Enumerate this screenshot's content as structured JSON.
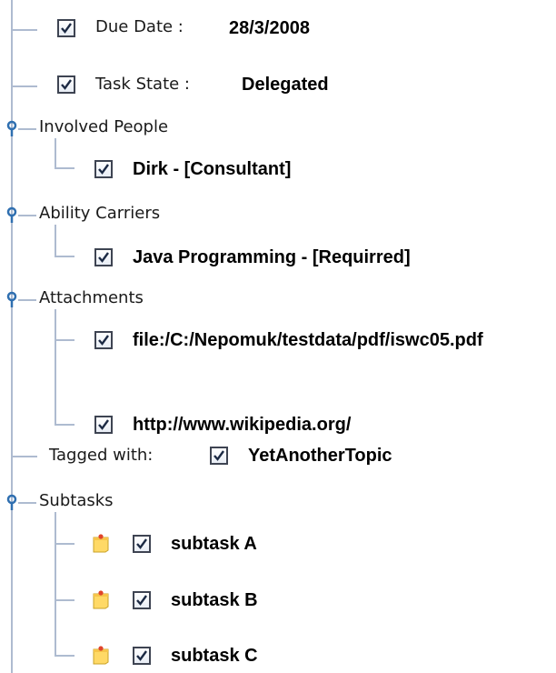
{
  "due_date": {
    "label": "Due Date :",
    "value": "28/3/2008",
    "checked": true
  },
  "task_state": {
    "label": "Task State :",
    "value": "Delegated",
    "checked": true
  },
  "involved_people": {
    "label": "Involved People",
    "items": [
      {
        "value": "Dirk - [Consultant]",
        "checked": true
      }
    ]
  },
  "ability_carriers": {
    "label": "Ability Carriers",
    "items": [
      {
        "value": "Java Programming - [Requirred]",
        "checked": true
      }
    ]
  },
  "attachments": {
    "label": "Attachments",
    "items": [
      {
        "value": "file:/C:/Nepomuk/testdata/pdf/iswc05.pdf",
        "checked": true
      },
      {
        "value": "http://www.wikipedia.org/",
        "checked": true
      }
    ]
  },
  "tagged_with": {
    "label": "Tagged with:",
    "value": "YetAnotherTopic",
    "checked": true
  },
  "subtasks": {
    "label": "Subtasks",
    "items": [
      {
        "value": "subtask A",
        "checked": true,
        "icon": "note-icon"
      },
      {
        "value": "subtask B",
        "checked": true,
        "icon": "note-icon"
      },
      {
        "value": "subtask C",
        "checked": true,
        "icon": "note-icon"
      }
    ]
  },
  "colors": {
    "tree_line": "#aebbd0",
    "node": "#2f6fb0",
    "note_yellow": "#ffd966",
    "note_pin": "#e0442a"
  }
}
